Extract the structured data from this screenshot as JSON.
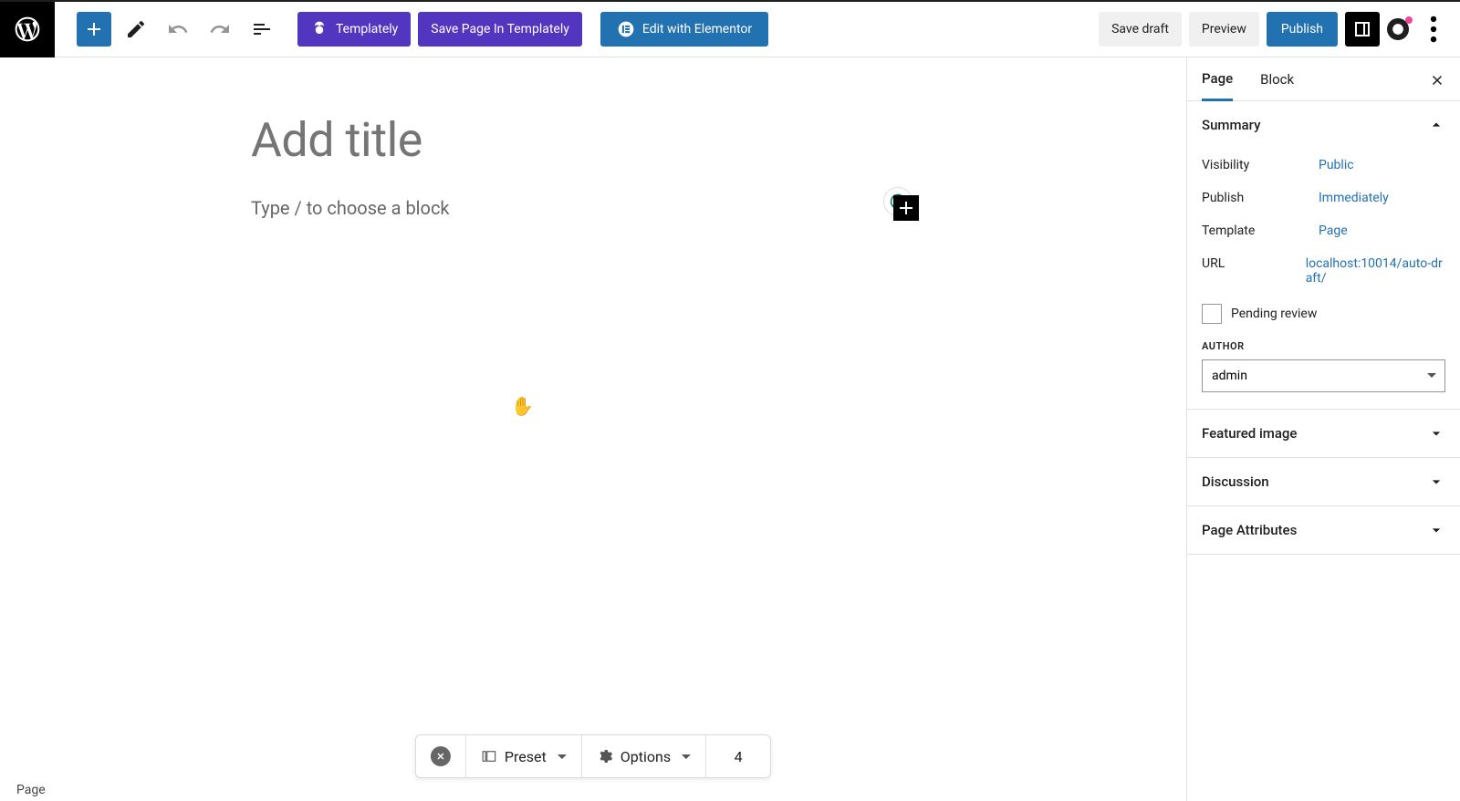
{
  "toolbar": {
    "templately": "Templately",
    "save_templately": "Save Page In Templately",
    "edit_elementor": "Edit with Elementor",
    "save_draft": "Save draft",
    "preview": "Preview",
    "publish": "Publish"
  },
  "editor": {
    "title_placeholder": "Add title",
    "block_placeholder": "Type / to choose a block"
  },
  "sidebar": {
    "tabs": {
      "page": "Page",
      "block": "Block"
    },
    "summary": {
      "title": "Summary",
      "visibility_label": "Visibility",
      "visibility_value": "Public",
      "publish_label": "Publish",
      "publish_value": "Immediately",
      "template_label": "Template",
      "template_value": "Page",
      "url_label": "URL",
      "url_value": "localhost:10014/auto-draft/",
      "pending_review": "Pending review",
      "author_label": "AUTHOR",
      "author_value": "admin"
    },
    "panels": {
      "featured_image": "Featured image",
      "discussion": "Discussion",
      "page_attributes": "Page Attributes"
    }
  },
  "floatbar": {
    "preset": "Preset",
    "options": "Options",
    "value": "4"
  },
  "footer": {
    "breadcrumb": "Page"
  }
}
